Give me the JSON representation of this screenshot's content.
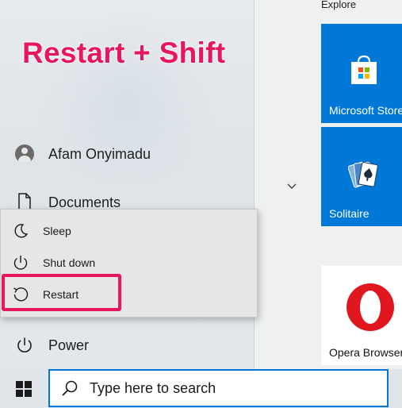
{
  "overlay": {
    "title": "Restart + Shift"
  },
  "start_menu": {
    "user_name": "Afam Onyimadu",
    "documents_label": "Documents",
    "power_label": "Power"
  },
  "power_flyout": {
    "items": [
      {
        "label": "Sleep",
        "icon": "moon-icon"
      },
      {
        "label": "Shut down",
        "icon": "power-icon"
      },
      {
        "label": "Restart",
        "icon": "restart-icon"
      }
    ],
    "highlighted": "Restart",
    "highlight_color": "#e8175d"
  },
  "tiles": {
    "group_label": "Explore",
    "items": [
      {
        "label": "Microsoft Store",
        "icon": "store-bag-icon",
        "bg": "#0078d7"
      },
      {
        "label": "Solitaire",
        "icon": "playing-cards-icon",
        "bg": "#0078d7"
      },
      {
        "label": "Opera Browser",
        "icon": "opera-logo-icon",
        "bg": "#ffffff"
      }
    ]
  },
  "taskbar": {
    "search_placeholder": "Type here to search",
    "accent": "#0078d7"
  }
}
